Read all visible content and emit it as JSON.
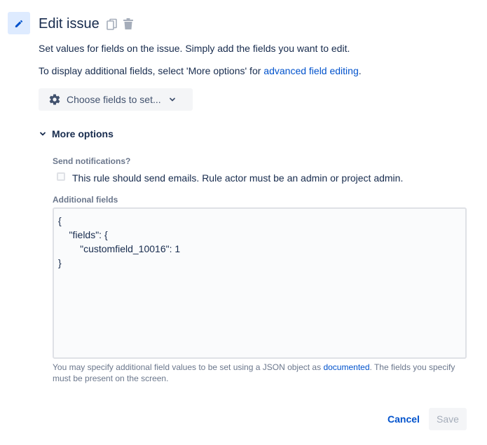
{
  "header": {
    "title": "Edit issue",
    "icon": "pencil-icon",
    "accent_color": "#0052cc",
    "icon_bg_color": "#deebff"
  },
  "description": {
    "line1": "Set values for fields on the issue. Simply add the fields you want to edit.",
    "line2_prefix": "To display additional fields, select 'More options' for ",
    "line2_link": "advanced field editing",
    "line2_suffix": "."
  },
  "choose_fields": {
    "label": "Choose fields to set..."
  },
  "more_options": {
    "label": "More options",
    "expanded": true
  },
  "notifications": {
    "label": "Send notifications?",
    "checkbox_label": "This rule should send emails. Rule actor must be an admin or project admin.",
    "checked": false
  },
  "additional_fields": {
    "label": "Additional fields",
    "value": "{\n    \"fields\": {\n        \"customfield_10016\": 1\n}",
    "help_prefix": "You may specify additional field values to be set using a JSON object as ",
    "help_link": "documented",
    "help_suffix": ". The fields you specify must be present on the screen."
  },
  "actions": {
    "cancel_label": "Cancel",
    "save_label": "Save",
    "save_enabled": false
  }
}
